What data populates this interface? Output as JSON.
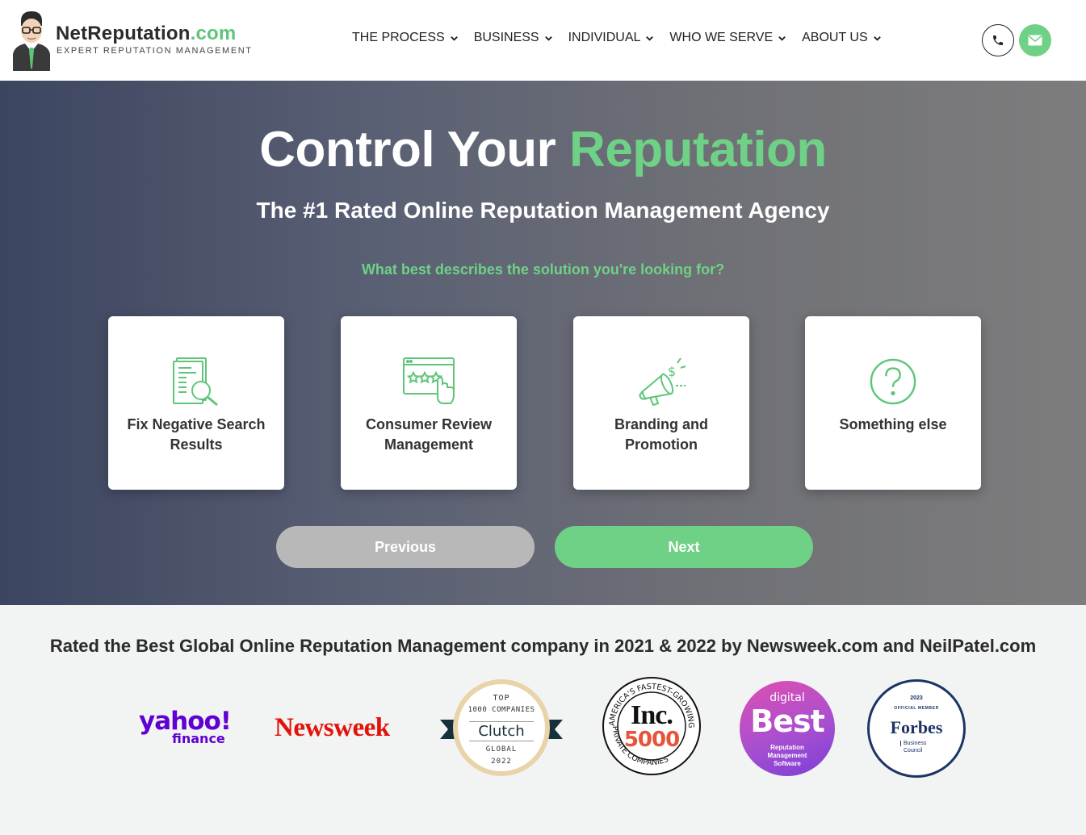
{
  "brand": {
    "name": "NetReputation",
    "suffix": ".com",
    "tagline": "EXPERT REPUTATION MANAGEMENT"
  },
  "nav": {
    "items": [
      {
        "label": "THE PROCESS"
      },
      {
        "label": "BUSINESS"
      },
      {
        "label": "INDIVIDUAL"
      },
      {
        "label": "WHO WE SERVE"
      },
      {
        "label": "ABOUT US"
      }
    ]
  },
  "hero": {
    "title_white": "Control Your",
    "title_green": "Reputation",
    "subtitle": "The #1 Rated Online Reputation Management Agency",
    "question": "What best describes the solution you're looking for?",
    "cards": [
      {
        "label": "Fix Negative Search Results",
        "icon": "search-results-icon"
      },
      {
        "label": "Consumer Review Management",
        "icon": "review-stars-icon"
      },
      {
        "label": "Branding and Promotion",
        "icon": "megaphone-icon"
      },
      {
        "label": "Something else",
        "icon": "question-icon"
      }
    ],
    "prev_label": "Previous",
    "next_label": "Next"
  },
  "rated": {
    "text": "Rated the Best Global Online Reputation Management company in 2021 & 2022 by Newsweek.com and NeilPatel.com",
    "badges": {
      "yahoo": {
        "top": "yahoo!",
        "bottom": "finance"
      },
      "newsweek": "Newsweek",
      "clutch": {
        "top": "TOP",
        "line2": "1000 COMPANIES",
        "name": "Clutch",
        "line3": "GLOBAL",
        "year": "2022"
      },
      "inc": {
        "name": "Inc.",
        "num": "5000",
        "top": "AMERICA'S FASTEST-GROWING",
        "bottom": "PRIVATE COMPANIES"
      },
      "digital_best": {
        "top": "digital",
        "name": "Best",
        "sub1": "Reputation",
        "sub2": "Management",
        "sub3": "Software"
      },
      "forbes": {
        "year": "2023",
        "top": "OFFICIAL MEMBER",
        "name": "Forbes",
        "sub1": "Business",
        "sub2": "Council"
      }
    }
  },
  "colors": {
    "accent": "#6fd186",
    "text_dark": "#2b2b2b",
    "prev_button": "#b8b8b8",
    "hero_start": "#3c4560",
    "hero_end": "#7d7d7d"
  }
}
